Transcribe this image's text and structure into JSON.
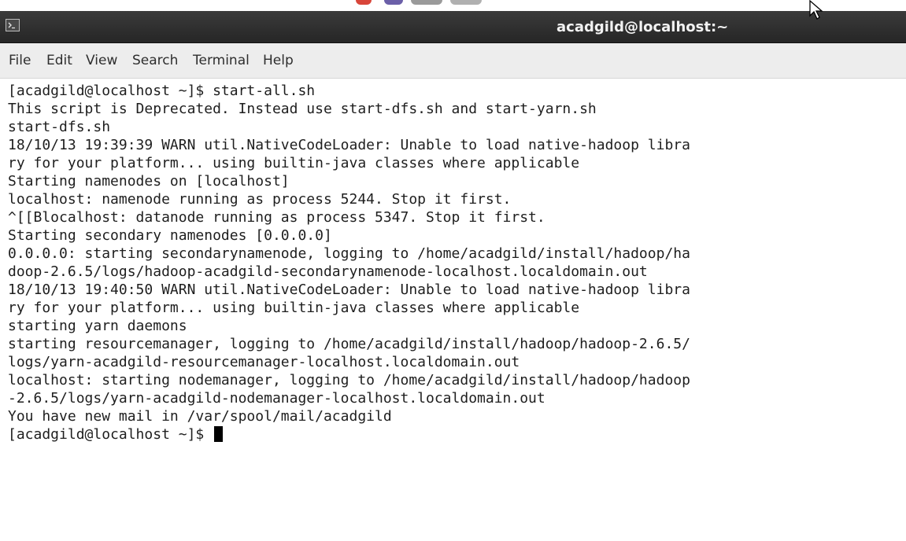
{
  "window": {
    "title": "acadgild@localhost:~"
  },
  "menu": {
    "items": [
      "File",
      "Edit",
      "View",
      "Search",
      "Terminal",
      "Help"
    ]
  },
  "terminal": {
    "lines": [
      "[acadgild@localhost ~]$ start-all.sh",
      "This script is Deprecated. Instead use start-dfs.sh and start-yarn.sh",
      "start-dfs.sh",
      "18/10/13 19:39:39 WARN util.NativeCodeLoader: Unable to load native-hadoop libra",
      "ry for your platform... using builtin-java classes where applicable",
      "Starting namenodes on [localhost]",
      "localhost: namenode running as process 5244. Stop it first.",
      "^[[Blocalhost: datanode running as process 5347. Stop it first.",
      "Starting secondary namenodes [0.0.0.0]",
      "0.0.0.0: starting secondarynamenode, logging to /home/acadgild/install/hadoop/ha",
      "doop-2.6.5/logs/hadoop-acadgild-secondarynamenode-localhost.localdomain.out",
      "18/10/13 19:40:50 WARN util.NativeCodeLoader: Unable to load native-hadoop libra",
      "ry for your platform... using builtin-java classes where applicable",
      "starting yarn daemons",
      "starting resourcemanager, logging to /home/acadgild/install/hadoop/hadoop-2.6.5/",
      "logs/yarn-acadgild-resourcemanager-localhost.localdomain.out",
      "localhost: starting nodemanager, logging to /home/acadgild/install/hadoop/hadoop",
      "-2.6.5/logs/yarn-acadgild-nodemanager-localhost.localdomain.out",
      "You have new mail in /var/spool/mail/acadgild"
    ],
    "prompt": "[acadgild@localhost ~]$ "
  },
  "colors": {
    "titlebar": "#2f2f2f",
    "menubar": "#ededed",
    "background": "#ffffff",
    "text": "#1e1e1e"
  },
  "icons": {
    "window_icon": "terminal-icon",
    "pointer": "mouse-pointer-icon"
  }
}
